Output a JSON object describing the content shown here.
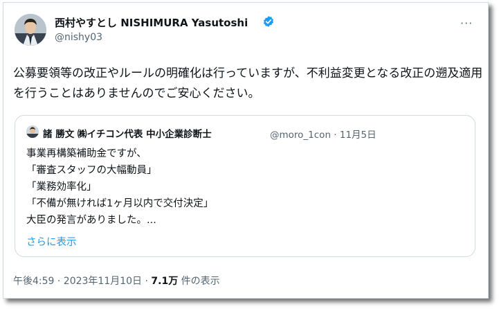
{
  "author": {
    "display_name": "西村やすとし NISHIMURA Yasutoshi",
    "handle": "@nishy03",
    "verified_icon": "verified-badge-icon",
    "verified_color": "#1d9bf0"
  },
  "more_icon": "more-horizontal-icon",
  "more_glyph": "···",
  "tweet": {
    "text": "公募要領等の改正やルールの明確化は行っていますが、不利益変更となる改正の遡及適用を行うことはありませんのでご安心ください。"
  },
  "quote": {
    "author_name": "諸 勝文 ㈱イチコン代表 中小企業診断士",
    "handle_date": "@moro_1con · 11月5日",
    "lines": [
      "事業再構築補助金ですが、",
      "「審査スタッフの大幅動員」",
      "「業務効率化」",
      "「不備が無ければ1ヶ月以内で交付決定」",
      "大臣の発言がありました。..."
    ],
    "show_more": "さらに表示"
  },
  "meta": {
    "time_date": "午後4:59 · 2023年11月10日 · ",
    "views": "7.1万",
    "views_suffix": " 件の表示"
  },
  "colors": {
    "link": "#1d9bf0",
    "secondary_text": "#536471",
    "border": "#cfd9de"
  }
}
